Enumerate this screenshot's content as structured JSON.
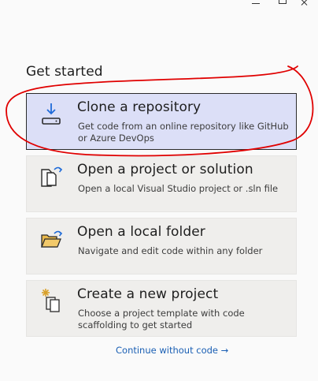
{
  "header": {
    "title": "Get started"
  },
  "cards": [
    {
      "title": "Clone a repository",
      "description": "Get code from an online repository like GitHub or Azure DevOps",
      "icon": "download-drive-icon",
      "selected": true
    },
    {
      "title": "Open a project or solution",
      "description": "Open a local Visual Studio project or .sln file",
      "icon": "open-project-icon",
      "selected": false
    },
    {
      "title": "Open a local folder",
      "description": "Navigate and edit code within any folder",
      "icon": "open-folder-icon",
      "selected": false
    },
    {
      "title": "Create a new project",
      "description": "Choose a project template with code scaffolding to get started",
      "icon": "new-project-icon",
      "selected": false
    }
  ],
  "footer": {
    "continue_label": "Continue without code →"
  },
  "colors": {
    "selected_background": "#dcdff7",
    "card_background": "#efeeec",
    "link": "#1a5fb4",
    "annotation_stroke": "#e00000",
    "icon_accent_blue": "#1e6ad8",
    "icon_folder_gold": "#d8a02a"
  }
}
